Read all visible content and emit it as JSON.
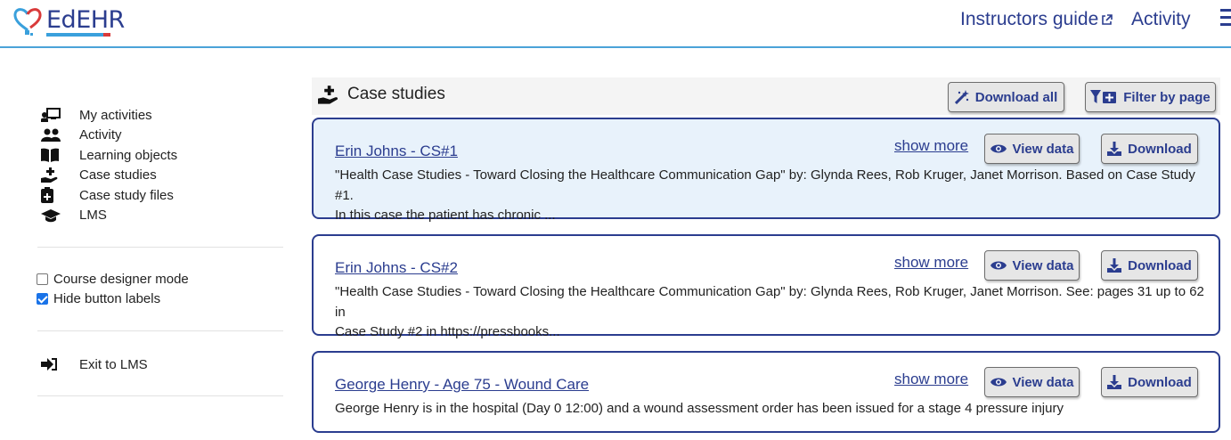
{
  "header": {
    "logo_text": "EdEHR",
    "instructors_guide": "Instructors guide",
    "activity": "Activity"
  },
  "sidebar": {
    "items": [
      {
        "label": "My activities",
        "icon": "chalkboard-user-icon"
      },
      {
        "label": "Activity",
        "icon": "users-icon"
      },
      {
        "label": "Learning objects",
        "icon": "book-open-icon"
      },
      {
        "label": "Case studies",
        "icon": "hand-holding-medical-icon"
      },
      {
        "label": "Case study files",
        "icon": "file-medical-icon"
      },
      {
        "label": "LMS",
        "icon": "graduation-cap-icon"
      }
    ],
    "course_designer_mode": "Course designer mode",
    "hide_button_labels": "Hide button labels",
    "exit": "Exit to LMS"
  },
  "main": {
    "title": "Case studies",
    "download_all": "Download all",
    "filter_by_page": "Filter by page",
    "show_more": "show more",
    "view_data": "View data",
    "download": "Download",
    "cards": [
      {
        "title": "Erin Johns - CS#1",
        "line1": "\"Health Case Studies - Toward Closing the Healthcare Communication Gap\" by: Glynda Rees, Rob Kruger, Janet Morrison. Based on Case Study #1.",
        "line2": "In this case the patient has chronic ..."
      },
      {
        "title": "Erin Johns - CS#2",
        "line1": "\"Health Case Studies - Toward Closing the Healthcare Communication Gap\" by: Glynda Rees, Rob Kruger, Janet Morrison. See: pages 31 up to 62 in",
        "line2": "Case Study #2 in https://pressbooks..."
      },
      {
        "title": "George Henry - Age 75 - Wound Care",
        "line1": "George Henry is in the hospital (Day 0 12:00) and a wound assessment order has been issued for a stage 4 pressure injury",
        "line2": ""
      }
    ]
  },
  "colors": {
    "brand": "#2b3d8f",
    "accent": "#3aa0dc",
    "selected_card": "#e8f2fb"
  }
}
